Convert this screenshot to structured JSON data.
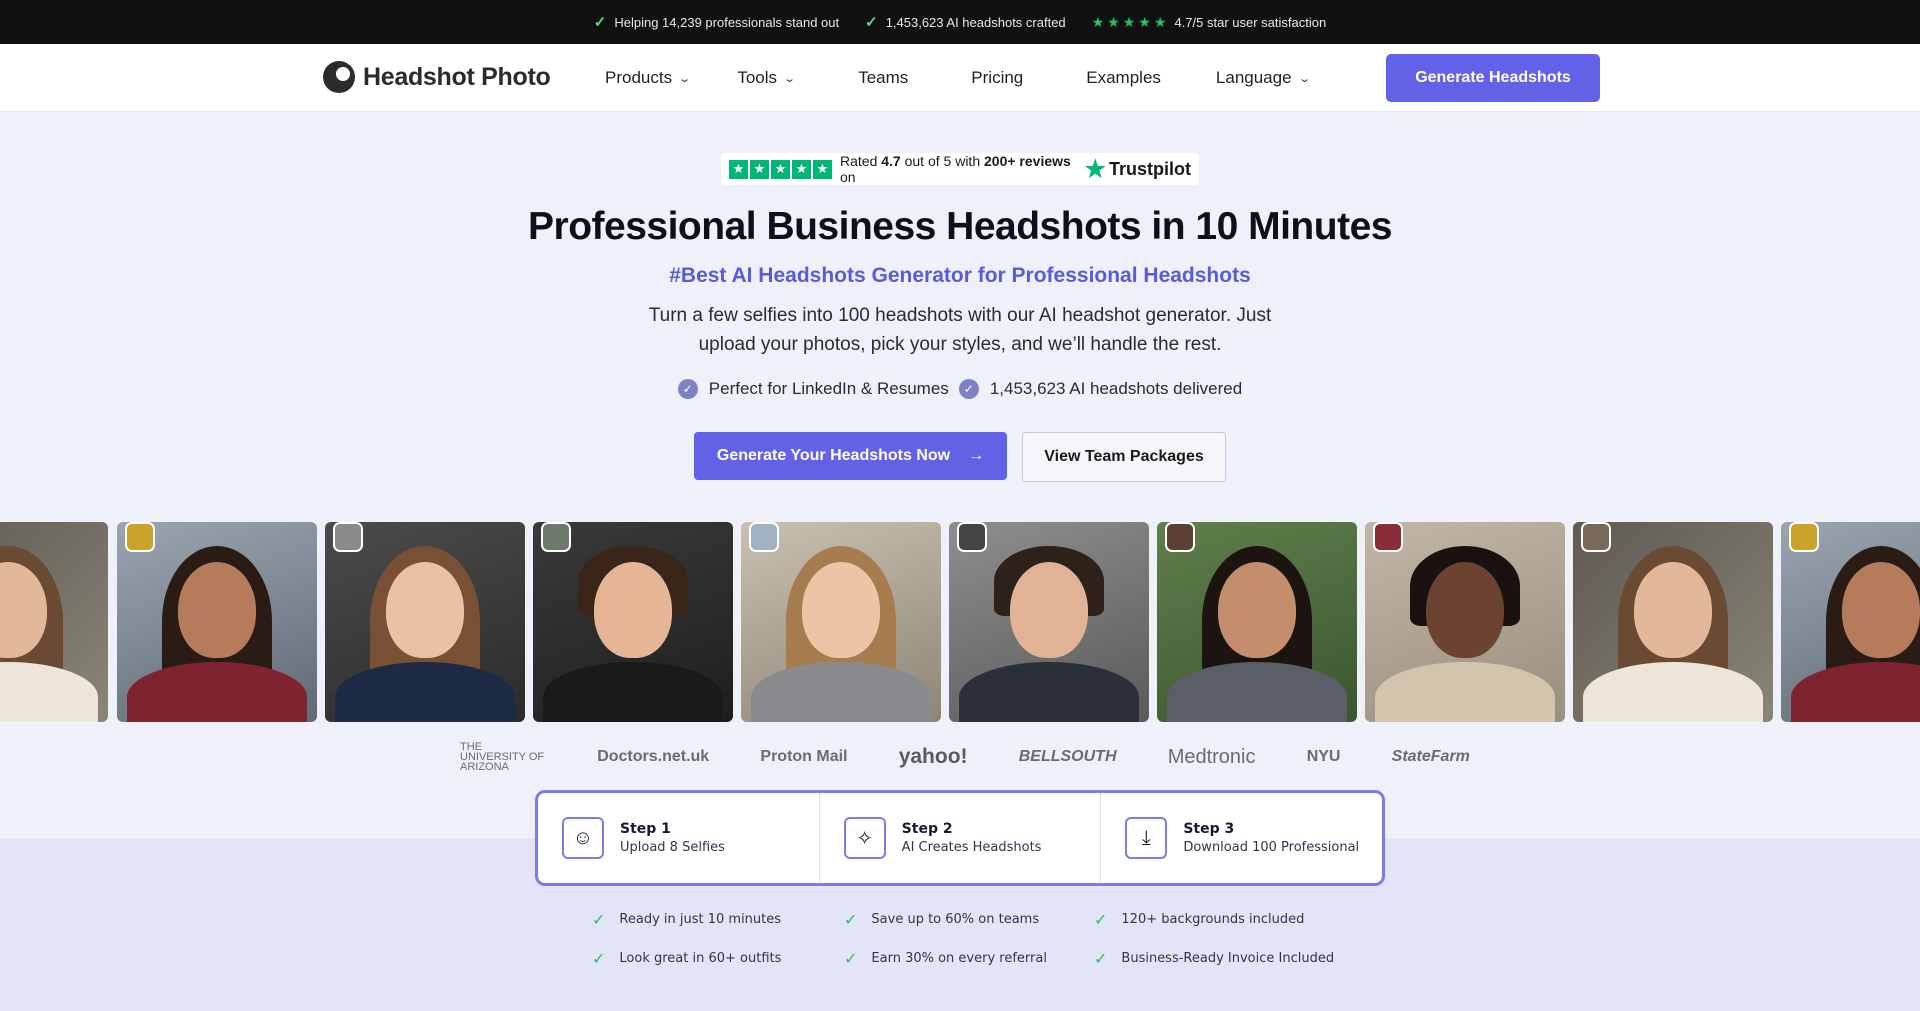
{
  "topbar": {
    "items": [
      {
        "text": "Helping 14,239 professionals stand out"
      },
      {
        "text": "1,453,623 AI headshots crafted"
      }
    ],
    "rating_text": "4.7/5 star user satisfaction"
  },
  "nav": {
    "logo_text": "Headshot Photo",
    "items": [
      {
        "label": "Products",
        "dropdown": true
      },
      {
        "label": "Tools",
        "dropdown": true
      },
      {
        "label": "Teams",
        "dropdown": false
      },
      {
        "label": "Pricing",
        "dropdown": false
      },
      {
        "label": "Examples",
        "dropdown": false
      },
      {
        "label": "Language",
        "dropdown": true
      }
    ],
    "cta_label": "Generate Headshots"
  },
  "trustpilot": {
    "prefix": "Rated",
    "score": "4.7",
    "middle": "out of 5 with",
    "reviews": "200+ reviews",
    "suffix": "on",
    "brand": "Trustpilot"
  },
  "hero": {
    "title": "Professional Business Headshots in 10 Minutes",
    "subtitle": "#Best AI Headshots Generator for Professional Headshots",
    "description": "Turn a few selfies into 100 headshots with our AI headshot generator. Just upload your photos, pick your styles, and we’ll handle the rest.",
    "features": [
      "Perfect for LinkedIn & Resumes",
      "1,453,623 AI headshots delivered"
    ],
    "primary_cta": "Generate Your Headshots Now",
    "secondary_cta": "View Team Packages"
  },
  "logos": {
    "items": [
      "THE UNIVERSITY OF ARIZONA",
      "Doctors.net.uk",
      "Proton Mail",
      "yahoo!",
      "BELLSOUTH",
      "Medtronic",
      "NYU",
      "StateFarm"
    ]
  },
  "steps": [
    {
      "title": "Step 1",
      "desc": "Upload 8 Selfies",
      "icon": "smile-icon"
    },
    {
      "title": "Step 2",
      "desc": "AI Creates Headshots",
      "icon": "sparkle-icon"
    },
    {
      "title": "Step 3",
      "desc": "Download 100 Professional",
      "icon": "download-icon"
    }
  ],
  "benefits": [
    "Ready in just 10 minutes",
    "Save up to 60% on teams",
    "120+ backgrounds included",
    "Look great in 60+ outfits",
    "Earn 30% on every referral",
    "Business-Ready Invoice Included"
  ],
  "colors": {
    "accent": "#6362e7",
    "topbar_bg": "#111111",
    "hero_bg": "#eef0fa",
    "trustpilot_green": "#00b67a"
  }
}
